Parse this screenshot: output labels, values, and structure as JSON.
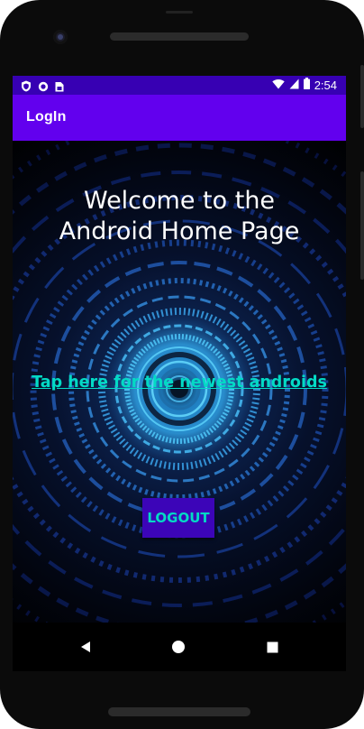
{
  "status_bar": {
    "time": "2:54",
    "icons": [
      "shield-icon",
      "circle-icon",
      "sim-card-icon",
      "wifi-icon",
      "signal-icon",
      "battery-icon"
    ]
  },
  "app_bar": {
    "title": "LogIn",
    "color": "#6200ee"
  },
  "main": {
    "welcome_line1": "Welcome to the",
    "welcome_line2": "Android Home Page",
    "newest_link": "Tap here for the newest androids",
    "logout_button": "LOGOUT",
    "accent_color": "#03dac5"
  },
  "nav_bar": {
    "buttons": [
      "back-icon",
      "home-icon",
      "recents-icon"
    ]
  }
}
